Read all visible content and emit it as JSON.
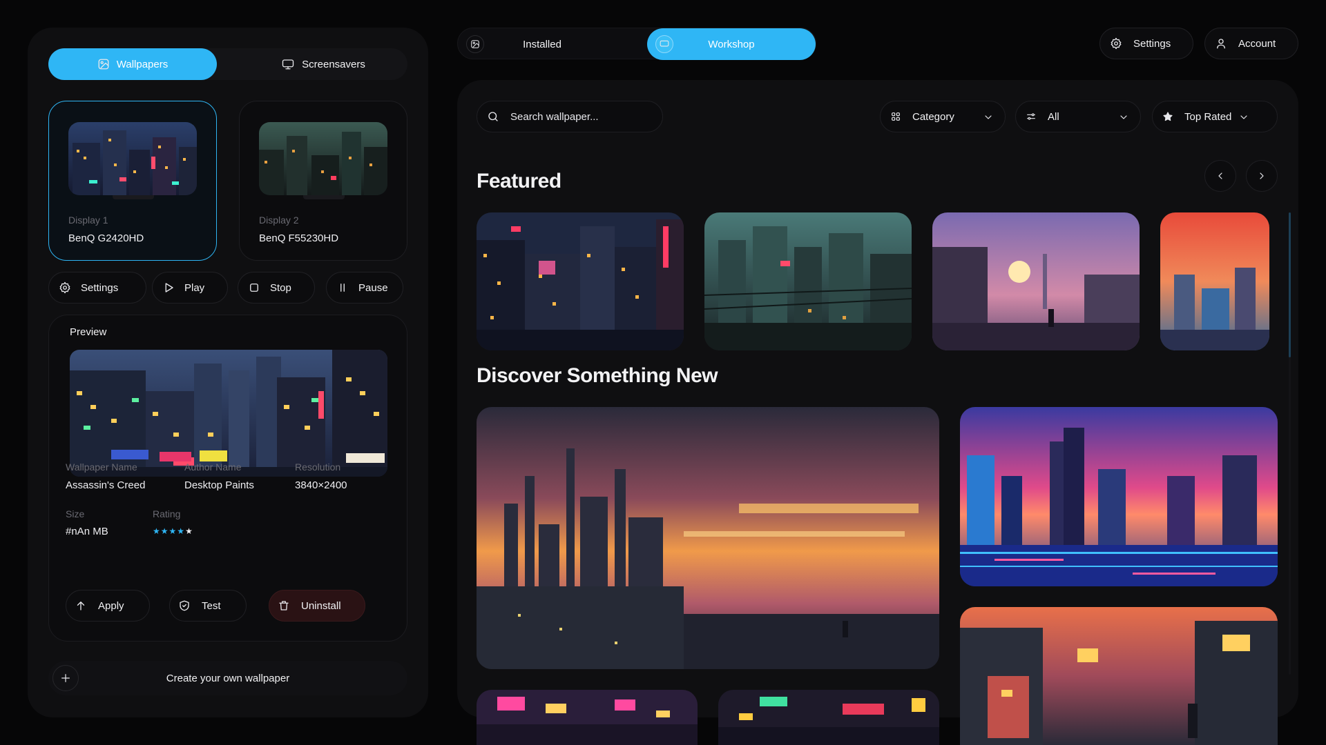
{
  "left": {
    "tabs": [
      {
        "label": "Wallpapers",
        "icon": "image-icon",
        "active": true
      },
      {
        "label": "Screensavers",
        "icon": "monitor-icon",
        "active": false
      }
    ],
    "displays": [
      {
        "label": "Display 1",
        "model": "BenQ G2420HD",
        "active": true
      },
      {
        "label": "Display 2",
        "model": "BenQ F55230HD",
        "active": false
      }
    ],
    "controls": [
      {
        "label": "Settings",
        "icon": "gear-icon"
      },
      {
        "label": "Play",
        "icon": "play-icon"
      },
      {
        "label": "Stop",
        "icon": "stop-icon"
      },
      {
        "label": "Pause",
        "icon": "pause-icon"
      }
    ],
    "preview": {
      "title": "Preview",
      "wallpaper_name_label": "Wallpaper Name",
      "wallpaper_name": "Assassin's Creed",
      "author_label": "Author Name",
      "author": "Desktop Paints",
      "resolution_label": "Resolution",
      "resolution": "3840×2400",
      "size_label": "Size",
      "size": "#nAn MB",
      "rating_label": "Rating",
      "rating": 4,
      "rating_max": 5
    },
    "actions": [
      {
        "label": "Apply",
        "icon": "arrow-up-icon"
      },
      {
        "label": "Test",
        "icon": "shield-icon"
      },
      {
        "label": "Uninstall",
        "icon": "trash-icon"
      }
    ],
    "create_label": "Create your own wallpaper"
  },
  "nav": {
    "tabs": [
      {
        "label": "Installed",
        "icon": "image-icon",
        "active": false
      },
      {
        "label": "Workshop",
        "icon": "monitor-icon",
        "active": true
      }
    ],
    "settings_label": "Settings",
    "account_label": "Account"
  },
  "main": {
    "search_placeholder": "Search wallpaper...",
    "filters": [
      {
        "label": "Category",
        "icon": "grid-icon"
      },
      {
        "label": "All",
        "icon": "sliders-icon"
      },
      {
        "label": "Top Rated",
        "icon": "star-icon"
      }
    ],
    "featured_title": "Featured",
    "discover_title": "Discover Something New"
  },
  "colors": {
    "accent": "#2fb6f5",
    "background": "#060607",
    "panel": "#0f0f11",
    "star": "#2fb6f5",
    "danger_bg": "#2a1214"
  }
}
